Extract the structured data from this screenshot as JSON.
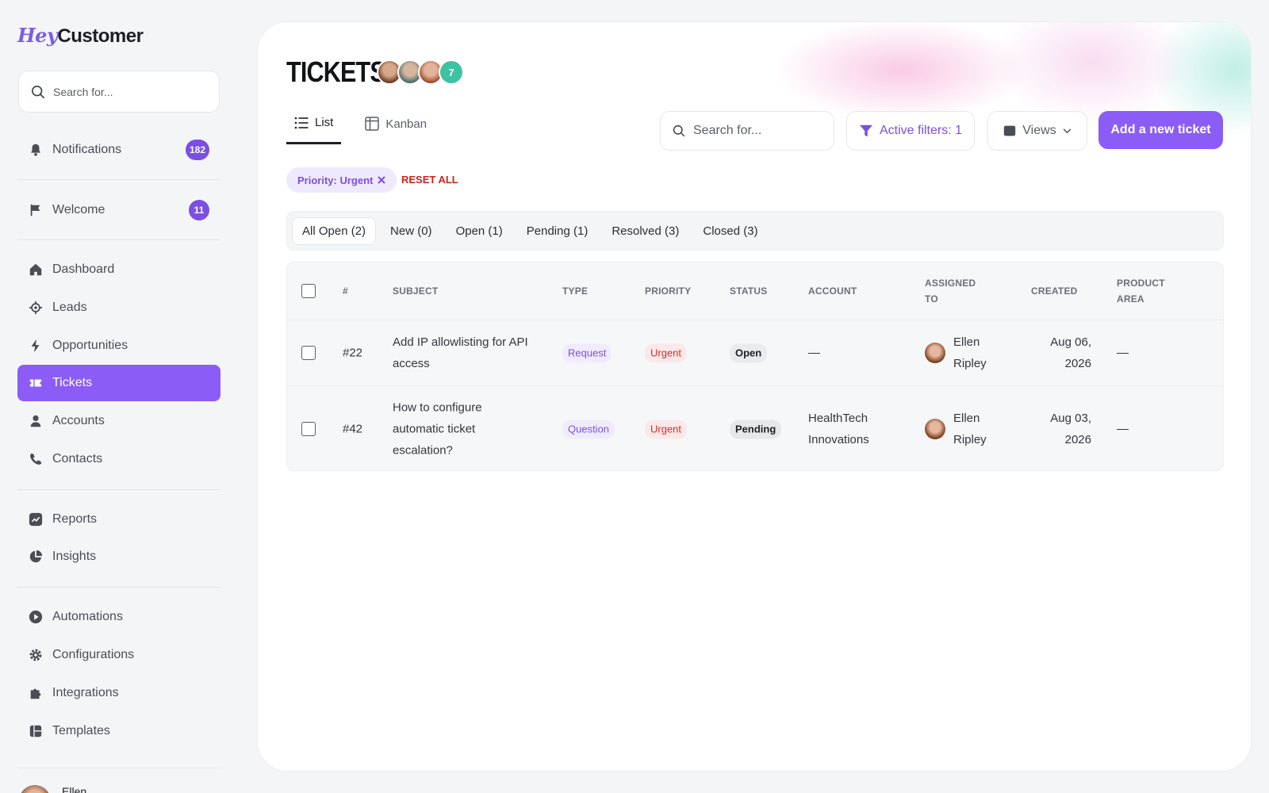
{
  "app": {
    "logo_hey": "Hey",
    "logo_customer": "Customer"
  },
  "sidebar": {
    "search_placeholder": "Search for...",
    "items": [
      {
        "label": "Notifications",
        "badge": "182",
        "icon": "bell-icon"
      },
      {
        "label": "Welcome",
        "badge": "11",
        "icon": "flag-icon"
      },
      {
        "label": "Dashboard",
        "icon": "home-icon"
      },
      {
        "label": "Leads",
        "icon": "target-icon"
      },
      {
        "label": "Opportunities",
        "icon": "bolt-icon"
      },
      {
        "label": "Tickets",
        "icon": "ticket-icon",
        "active": true
      },
      {
        "label": "Accounts",
        "icon": "user-icon"
      },
      {
        "label": "Contacts",
        "icon": "phone-icon"
      },
      {
        "label": "Reports",
        "icon": "chart-icon"
      },
      {
        "label": "Insights",
        "icon": "pie-icon"
      },
      {
        "label": "Automations",
        "icon": "play-icon"
      },
      {
        "label": "Configurations",
        "icon": "gear-icon"
      },
      {
        "label": "Integrations",
        "icon": "puzzle-icon"
      },
      {
        "label": "Templates",
        "icon": "template-icon"
      }
    ],
    "user_name": "Ellen"
  },
  "header": {
    "title": "TICKETS",
    "avatar_more_count": "7",
    "view_tabs": [
      {
        "label": "List",
        "active": true
      },
      {
        "label": "Kanban"
      }
    ],
    "search_placeholder": "Search for...",
    "active_filters_label": "Active filters: 1",
    "views_label": "Views",
    "add_button_label": "Add a new ticket"
  },
  "filters": {
    "chip_label": "Priority: Urgent",
    "reset_label": "RESET ALL"
  },
  "status_tabs": [
    {
      "label": "All Open (2)",
      "active": true
    },
    {
      "label": "New (0)"
    },
    {
      "label": "Open (1)"
    },
    {
      "label": "Pending (1)"
    },
    {
      "label": "Resolved (3)"
    },
    {
      "label": "Closed (3)"
    }
  ],
  "table": {
    "headers": {
      "num": "#",
      "subject": "SUBJECT",
      "type": "TYPE",
      "priority": "PRIORITY",
      "status": "STATUS",
      "account": "ACCOUNT",
      "assigned_1": "ASSIGNED",
      "assigned_2": "TO",
      "created": "CREATED",
      "product_1": "PRODUCT",
      "product_2": "AREA"
    },
    "rows": [
      {
        "num": "#22",
        "subject_1": "Add IP allowlisting for API",
        "subject_2": "access",
        "type": "Request",
        "priority": "Urgent",
        "status": "Open",
        "account": "—",
        "assignee_1": "Ellen",
        "assignee_2": "Ripley",
        "created_1": "Aug 06,",
        "created_2": "2026",
        "product_area": "—"
      },
      {
        "num": "#42",
        "subject_1": "How to configure",
        "subject_2": "automatic ticket",
        "subject_3": "escalation?",
        "type": "Question",
        "priority": "Urgent",
        "status": "Pending",
        "account_1": "HealthTech",
        "account_2": "Innovations",
        "assignee_1": "Ellen",
        "assignee_2": "Ripley",
        "created_1": "Aug 03,",
        "created_2": "2026",
        "product_area": "—"
      }
    ]
  },
  "colors": {
    "accent": "#8b5cf6",
    "reset": "#d0221c",
    "urgent": "#d0312c",
    "avatar_count": "#3fc1a4"
  }
}
